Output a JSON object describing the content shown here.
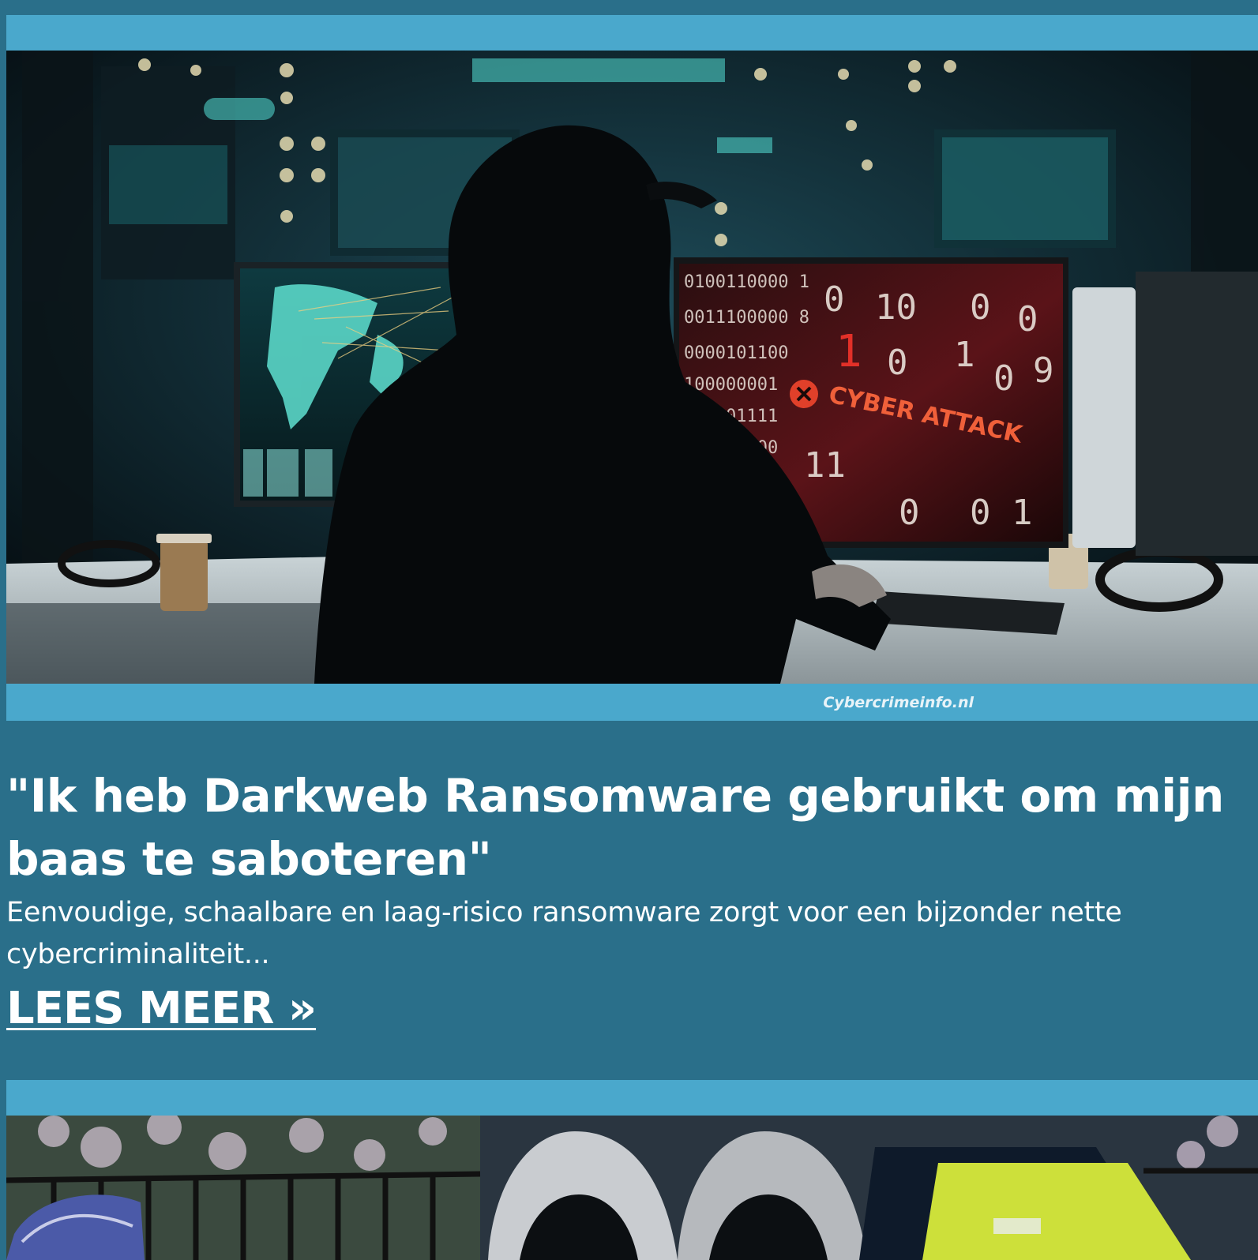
{
  "articles": [
    {
      "image_credit": "Cybercrimeinfo.nl",
      "image_screen_text": "CYBER ATTACK",
      "title": "\"Ik heb Darkweb Ransomware gebruikt om mijn baas te saboteren\"",
      "excerpt": "Eenvoudige, schaalbare en laag-risico ransomware zorgt voor een bijzonder nette cybercriminaliteit...",
      "read_more": "LEES MEER »"
    }
  ],
  "colors": {
    "page_bg": "#2a6f8a",
    "card_frame": "#4aa8cc",
    "text": "#ffffff",
    "alert_red": "#e0402a"
  },
  "icons": [
    "close-circle-icon"
  ]
}
